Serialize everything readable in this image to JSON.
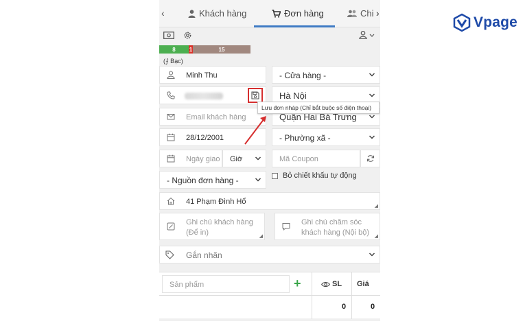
{
  "tabs": {
    "prev_arrow": "‹",
    "next_arrow": "›",
    "items": [
      {
        "label": "Khách hàng",
        "icon": "person-icon"
      },
      {
        "label": "Đơn hàng",
        "icon": "cart-icon",
        "active": true
      },
      {
        "label": "Chi",
        "icon": "users-icon"
      }
    ]
  },
  "status": {
    "segments": [
      {
        "value": "8",
        "color": "#4caf50"
      },
      {
        "value": "1",
        "color": "#d9342b"
      },
      {
        "value": "15",
        "color": "#a1887f"
      }
    ],
    "tier": "(⨍ Bạc)"
  },
  "form": {
    "customer_name": "Minh Thu",
    "store_select": "- Cửa hàng -",
    "city_select": "Hà Nội",
    "district_select": "Quận Hai Bà Trưng",
    "ward_select": "- Phường xã -",
    "email_placeholder": "Email khách hàng",
    "birthday": "28/12/2001",
    "delivery_date_placeholder": "Ngày giao",
    "hour_select": "Giờ",
    "coupon_placeholder": "Mã Coupon",
    "source_select": "- Nguồn đơn hàng -",
    "auto_discount_label": "Bỏ chiết khấu tự động",
    "address": "41 Phạm Đình Hổ",
    "customer_note_placeholder": "Ghi chú khách hàng (Để in)",
    "care_note_placeholder": "Ghi chú chăm sóc khách hàng (Nội bộ)",
    "tag_placeholder": "Gắn nhãn"
  },
  "tooltip": "Lưu đơn nháp (Chỉ bắt buộc số điện thoại)",
  "products": {
    "search_placeholder": "Sản phẩm",
    "add_symbol": "+",
    "qty_header": "SL",
    "price_header": "Giá",
    "qty_total": "0",
    "price_total": "0"
  },
  "brand": {
    "logo_text": "Vpage",
    "color": "#1e4aa8"
  },
  "colors": {
    "accent": "#3f7bc4",
    "highlight": "#d62f2f",
    "add": "#3aa64a"
  }
}
